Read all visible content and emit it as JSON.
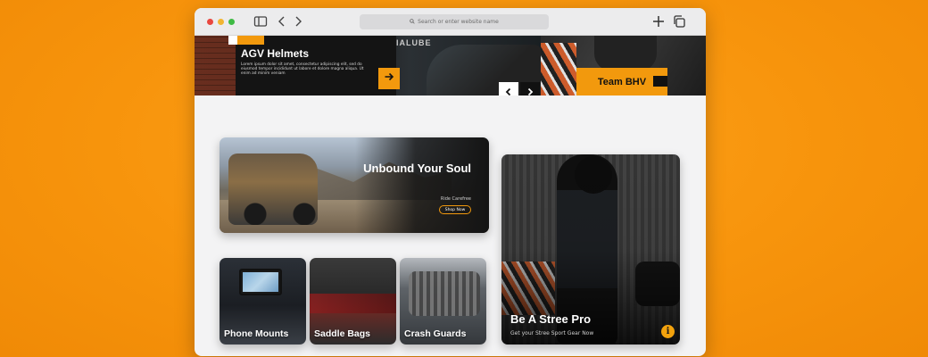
{
  "browser": {
    "address_placeholder": "Search or enter website name",
    "icons": [
      "sidebar-icon",
      "back-icon",
      "forward-icon",
      "new-tab-icon",
      "tabs-icon",
      "search-icon"
    ]
  },
  "hero": {
    "slide_title": "AGV Helmets",
    "slide_description": "Lorem ipsum dolor sit amet, consectetur adipiscing elit, sed do eiusmod tempor incididunt ut labore et dolore magna aliqua. Ut enim ad minim veniam",
    "bike_text": "IALUBE",
    "next_slide_label": "Team BHV"
  },
  "banner": {
    "title": "Unbound Your Soul",
    "subtitle": "Ride Carefree",
    "cta": "Shop Now"
  },
  "categories": [
    {
      "label": "Phone Mounts"
    },
    {
      "label": "Saddle Bags"
    },
    {
      "label": "Crash Guards"
    }
  ],
  "promo": {
    "title": "Be A Stree Pro",
    "subtitle": "Get your Stree Sport Gear Now",
    "info_icon": "info-icon"
  },
  "colors": {
    "accent": "#f2990d",
    "background": "#f7940c",
    "card_dark": "#141414"
  }
}
